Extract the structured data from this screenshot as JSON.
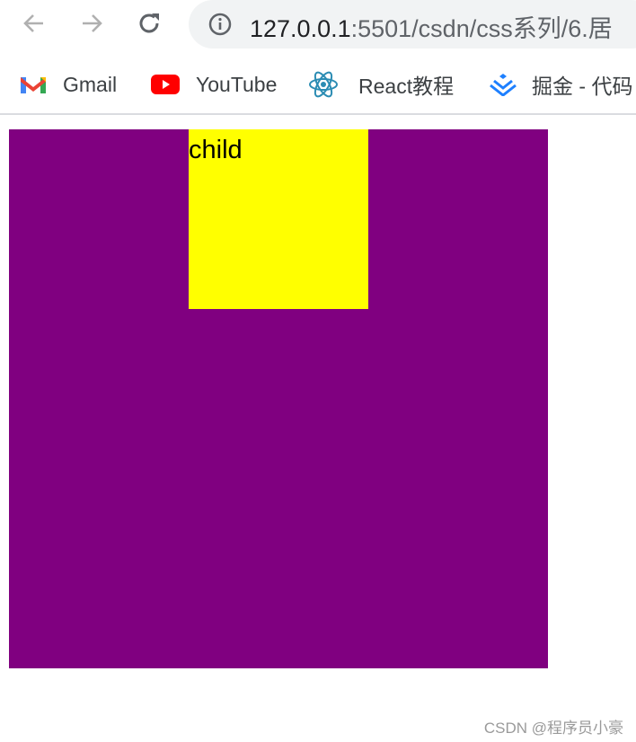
{
  "browser": {
    "url_host": "127.0.0.1",
    "url_rest": ":5501/csdn/css系列/6.居",
    "icons": [
      "back-arrow-icon",
      "forward-arrow-icon",
      "reload-icon",
      "info-icon"
    ]
  },
  "bookmarks": [
    {
      "label": "Gmail",
      "icon": "gmail-icon"
    },
    {
      "label": "YouTube",
      "icon": "youtube-icon"
    },
    {
      "label": "React教程",
      "icon": "react-icon"
    },
    {
      "label": "掘金 - 代码",
      "icon": "juejin-icon"
    }
  ],
  "page": {
    "child_label": "child",
    "parent_color": "#800080",
    "child_color": "#ffff00"
  },
  "watermark": "CSDN @程序员小豪"
}
